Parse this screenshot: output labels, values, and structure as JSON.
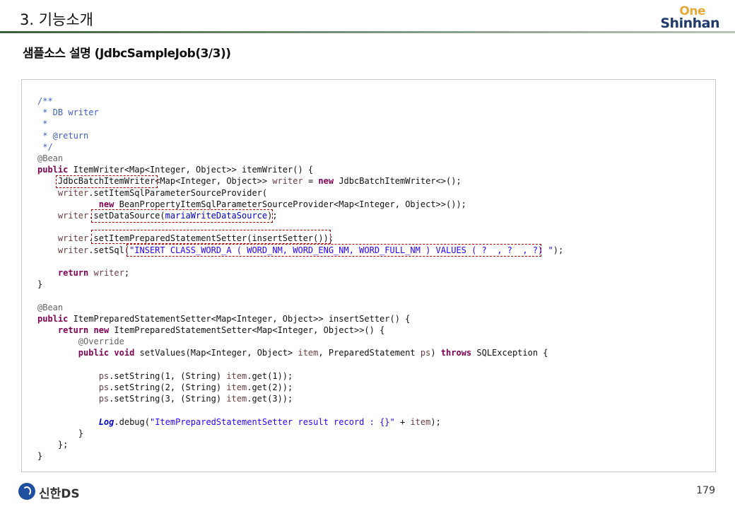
{
  "header": {
    "title": "3. 기능소개",
    "logo_top": "One",
    "logo_bottom": "Shinhan"
  },
  "subtitle": "샘플소스 설명 (JdbcSampleJob(3/3))",
  "code": {
    "l1": "/**",
    "l2": " * DB writer",
    "l3": " *",
    "l4": " * @return",
    "l5": " */",
    "ann_bean": "@Bean",
    "kw_public": "public",
    "kw_new": "new",
    "kw_return": "return",
    "kw_void": "void",
    "kw_throws": "throws",
    "ann_override": "@Override",
    "m1_sig": " ItemWriter<Map<Integer, Object>> itemWriter() {",
    "l8_type": "JdbcBatchItemWriter",
    "l8_rest": "<Map<Integer, Object>> ",
    "var_writer": "writer",
    "l8_eq": " = ",
    "l8_ctor": " JdbcBatchItemWriter<>();",
    "l9_call": ".setItemSqlParameterSourceProvider(",
    "l10_ctor": " BeanPropertyItemSqlParameterSourceProvider<Map<Integer, Object>>());",
    "l11_call": ".setDataSource(",
    "field_ds": "mariaWriteDataSource",
    "l11_end": ");",
    "l13_call": ".setItemPreparedStatementSetter(insertSetter());",
    "l14_call": ".setSql(",
    "sql": "\"INSERT CLASS_WORD_A ( WORD_NM, WORD_ENG_NM, WORD_FULL_NM ) VALUES ( ?  , ?  , ?) \"",
    "l14_end": ");",
    "l16_end": ";",
    "close": "}",
    "m2_sig": " ItemPreparedStatementSetter<Map<Integer, Object>> insertSetter() {",
    "l21_ctor": " ItemPreparedStatementSetter<Map<Integer, Object>>() {",
    "l23_a": " setValues(Map<Integer, Object> ",
    "var_item": "item",
    "l23_b": ", PreparedStatement ",
    "var_ps": "ps",
    "l23_c": ") ",
    "l23_d": " SQLException {",
    "l25_b": ".setString(1, (String) ",
    "l26_b": ".setString(2, (String) ",
    "l27_b": ".setString(3, (String) ",
    "get1": ".get(1));",
    "get2": ".get(2));",
    "get3": ".get(3));",
    "log": "Log",
    "l29_b": ".debug(",
    "log_str": "\"ItemPreparedStatementSetter result record : {}\"",
    "l29_c": " + ",
    "l29_d": ");",
    "close_inner": "}",
    "close_anon": "};",
    "close_outer": "}"
  },
  "footer": {
    "brand": "신한DS",
    "page_number": "179"
  },
  "colors": {
    "comment": "#3f5fbf",
    "keyword": "#7f0055",
    "string": "#2a00ff",
    "field": "#0000c0",
    "highlight": "#b00000",
    "header_line": "#3a5f3a",
    "brand_blue": "#1f3a6b",
    "brand_orange": "#e8a83a"
  }
}
